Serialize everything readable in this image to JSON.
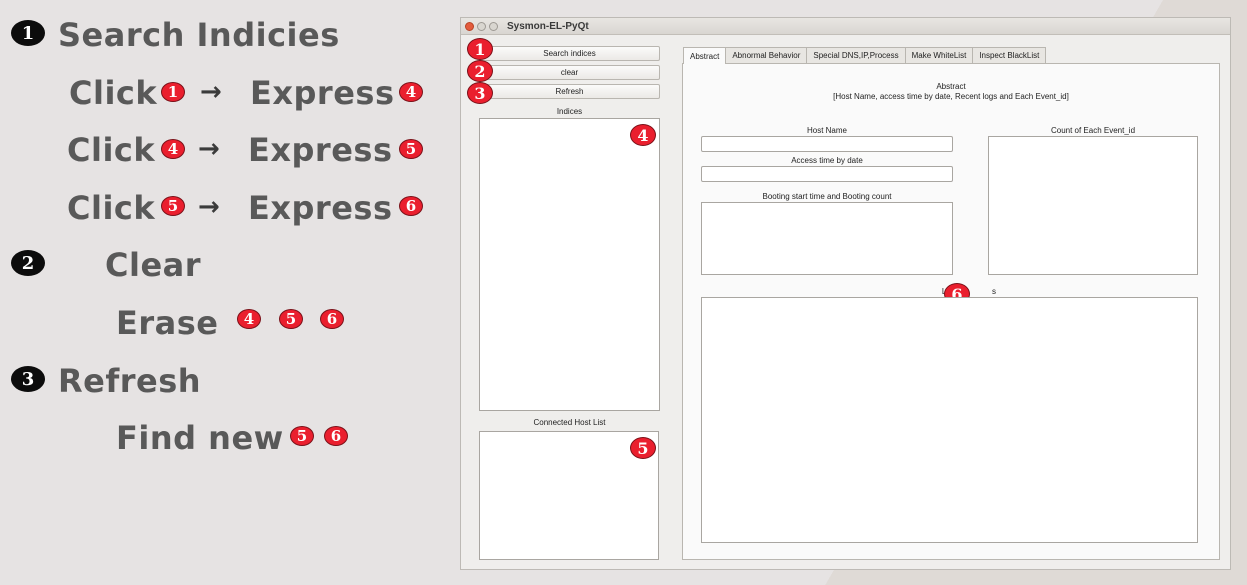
{
  "notes": {
    "step1": {
      "num": "1",
      "title": "Search Indicies"
    },
    "step1_lines": [
      {
        "click": "Click",
        "from": "1",
        "arrow": "→",
        "express": "Express",
        "to": "4"
      },
      {
        "click": "Click",
        "from": "4",
        "arrow": "→",
        "express": "Express",
        "to": "5"
      },
      {
        "click": "Click",
        "from": "5",
        "arrow": "→",
        "express": "Express",
        "to": "6"
      }
    ],
    "step2": {
      "num": "2",
      "title": "Clear",
      "sub": "Erase",
      "targets": [
        "4",
        "5",
        "6"
      ]
    },
    "step3": {
      "num": "3",
      "title": "Refresh",
      "sub": "Find new",
      "targets": [
        "5",
        "6"
      ]
    }
  },
  "window": {
    "title": "Sysmon-EL-PyQt",
    "buttons": {
      "search": "Search indices",
      "clear": "clear",
      "refresh": "Refresh"
    },
    "indices_label": "Indices",
    "hosts_label": "Connected Host List",
    "tabs": [
      "Abstract",
      "Abnormal Behavior",
      "Special DNS,IP,Process",
      "Make WhiteList",
      "Inspect BlackList"
    ],
    "abstract": {
      "heading": "Abstract",
      "subheading": "[Host Name, access time by date, Recent logs and Each Event_id]",
      "host_name_label": "Host Name",
      "access_time_label": "Access time by date",
      "booting_label": "Booting start time and Booting count",
      "event_count_label": "Count of Each Event_id",
      "last_logs_label_left": "Last",
      "last_logs_label_right": "s"
    },
    "markers": {
      "search": "1",
      "clear": "2",
      "refresh": "3",
      "indices": "4",
      "hosts": "5",
      "logs": "6"
    }
  },
  "colors": {
    "badge": "#ea1f2e",
    "bullet": "#0c0c0c",
    "note_text": "#595959"
  }
}
